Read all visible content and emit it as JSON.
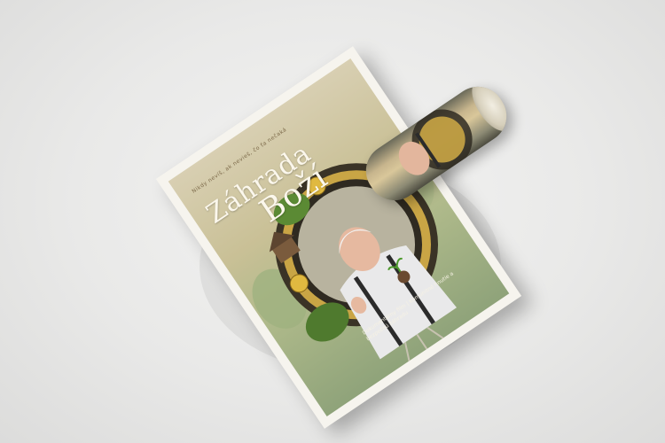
{
  "poster": {
    "tagline": "Nikdy nevíš, ak nevieš, čo ťa nečaká",
    "title_line1": "Záhrada",
    "title_line2": "Boží",
    "credits": "Dokumentárny film | Komunitné hnutie a bezpečnú záhradu"
  },
  "colors": {
    "background": "#ececeb",
    "poster_paper": "#f6f4ee",
    "title_text": "#fbf7ec",
    "clock_gold": "#c9a545",
    "clock_dark": "#2f2a21",
    "shirt": "#e9e9ea",
    "suspenders": "#2b2b2b",
    "foliage": "#4f7a2e"
  }
}
